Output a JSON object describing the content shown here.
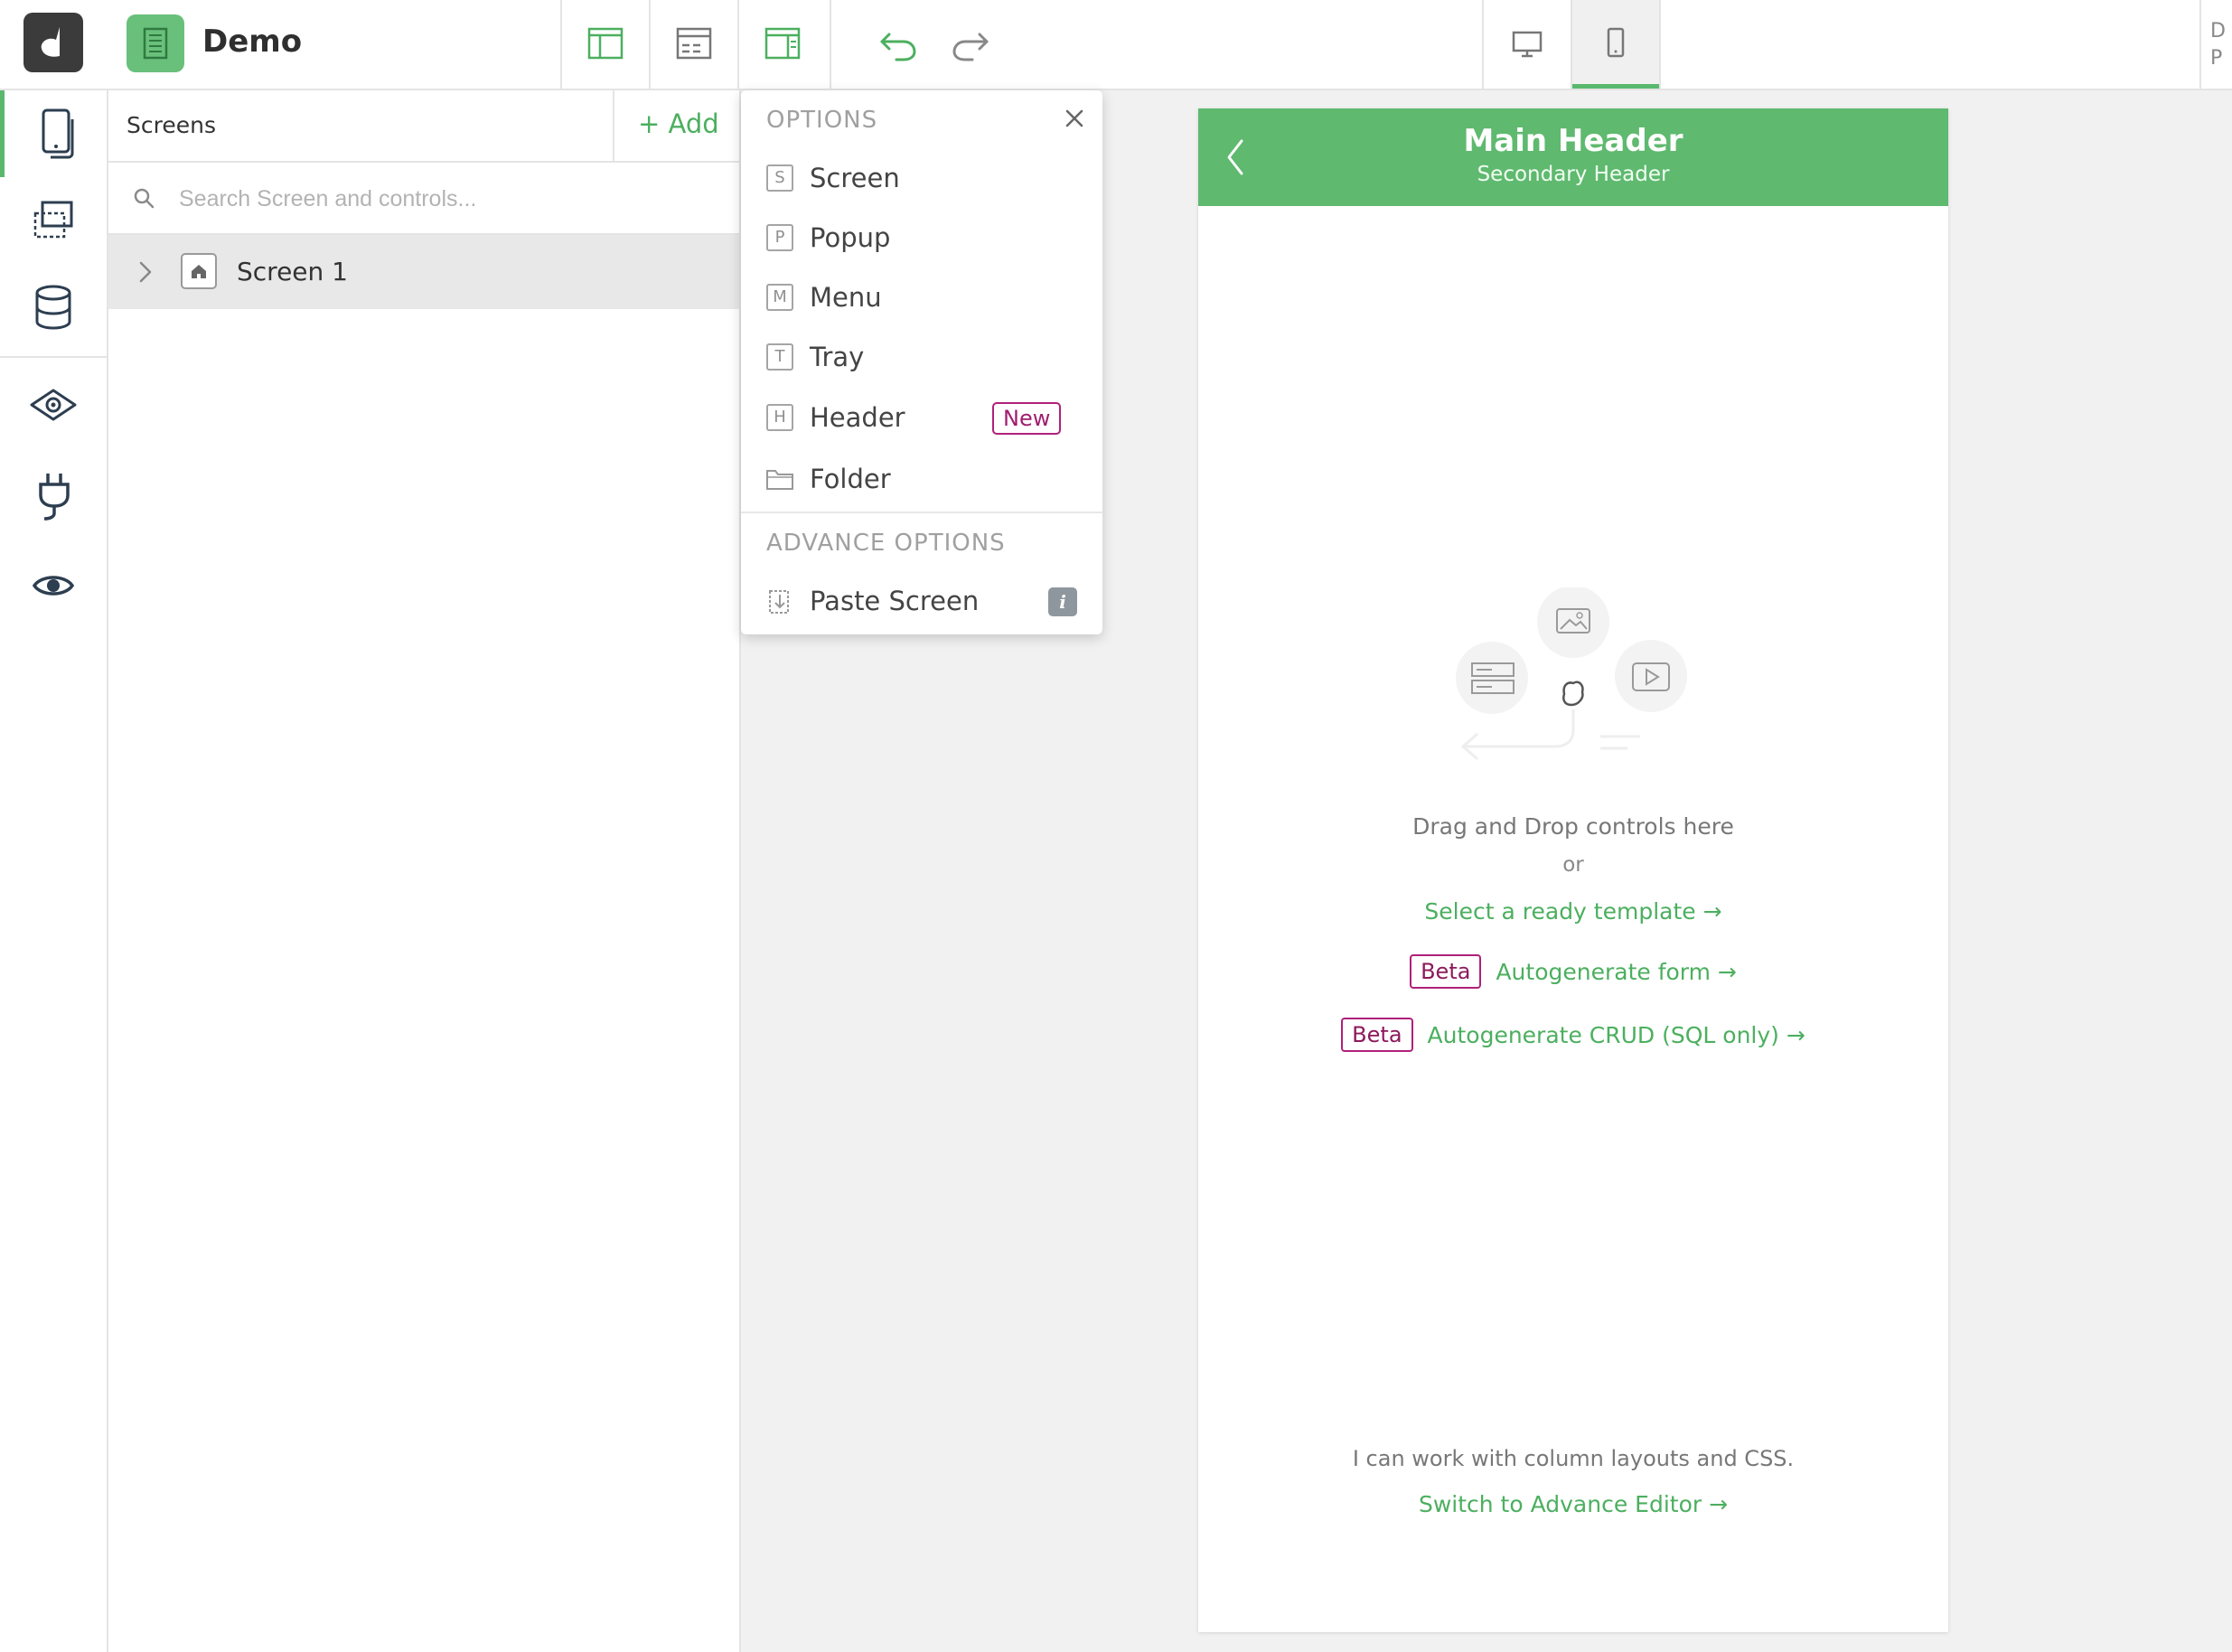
{
  "app": {
    "project_name": "Demo",
    "top_right_text": "D P"
  },
  "toolbar": {
    "layout_icons": [
      "layout-left-icon",
      "layout-table-icon",
      "layout-right-icon"
    ],
    "undo_icon": "undo-icon",
    "redo_icon": "redo-icon",
    "devices": [
      "desktop-icon",
      "mobile-icon"
    ],
    "active_device": "mobile"
  },
  "leftnav": {
    "items": [
      "screens-icon",
      "layers-icon",
      "database-icon",
      "view-icon",
      "plug-icon",
      "eye-icon"
    ],
    "active": "screens-icon"
  },
  "screens_panel": {
    "title": "Screens",
    "add_label": "+ Add",
    "search_placeholder": "Search Screen and controls...",
    "tree": [
      {
        "label": "Screen 1",
        "icon": "home-icon"
      }
    ]
  },
  "add_menu": {
    "options_heading": "OPTIONS",
    "items": [
      {
        "letter": "S",
        "label": "Screen"
      },
      {
        "letter": "P",
        "label": "Popup"
      },
      {
        "letter": "M",
        "label": "Menu"
      },
      {
        "letter": "T",
        "label": "Tray"
      },
      {
        "letter": "H",
        "label": "Header",
        "badge": "New"
      },
      {
        "letter": "",
        "label": "Folder",
        "icon": "folder-icon"
      }
    ],
    "advance_heading": "ADVANCE OPTIONS",
    "advance_items": [
      {
        "label": "Paste Screen",
        "icon": "paste-icon",
        "info": "i"
      }
    ]
  },
  "preview": {
    "main_header": "Main Header",
    "secondary_header": "Secondary Header",
    "drag_text": "Drag and Drop controls here",
    "or_text": "or",
    "template_link": "Select a ready template →",
    "autogen_badge": "Beta",
    "autogen_form": "Autogenerate form →",
    "crud_badge": "Beta",
    "autogen_crud": "Autogenerate CRUD (SQL only) →",
    "column_text": "I can work with column layouts and CSS.",
    "advance_link": "Switch to Advance Editor →"
  },
  "colors": {
    "accent": "#5fb96f",
    "link": "#4caf5f",
    "beta": "#b0207a",
    "logo": "#3b3b3b"
  }
}
